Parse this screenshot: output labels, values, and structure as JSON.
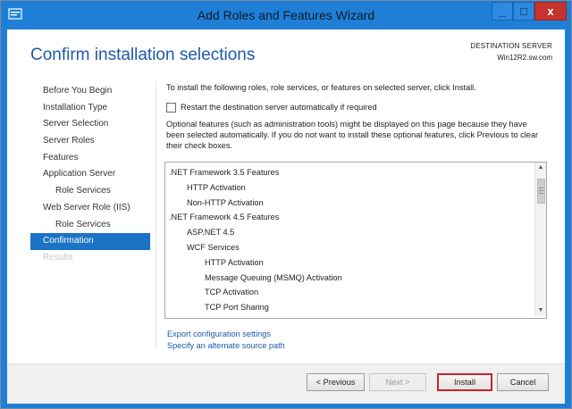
{
  "window": {
    "title": "Add Roles and Features Wizard",
    "controls": {
      "minimize": "_",
      "maximize": "□",
      "close": "x"
    }
  },
  "header": {
    "title": "Confirm installation selections",
    "destination_label": "DESTINATION SERVER",
    "destination_server": "Win12R2.sw.com"
  },
  "nav": {
    "items": [
      {
        "label": "Before You Begin",
        "level": 0,
        "state": "normal"
      },
      {
        "label": "Installation Type",
        "level": 0,
        "state": "normal"
      },
      {
        "label": "Server Selection",
        "level": 0,
        "state": "normal"
      },
      {
        "label": "Server Roles",
        "level": 0,
        "state": "normal"
      },
      {
        "label": "Features",
        "level": 0,
        "state": "normal"
      },
      {
        "label": "Application Server",
        "level": 0,
        "state": "normal"
      },
      {
        "label": "Role Services",
        "level": 1,
        "state": "normal"
      },
      {
        "label": "Web Server Role (IIS)",
        "level": 0,
        "state": "normal"
      },
      {
        "label": "Role Services",
        "level": 1,
        "state": "normal"
      },
      {
        "label": "Confirmation",
        "level": 0,
        "state": "active"
      },
      {
        "label": "Results",
        "level": 0,
        "state": "disabled"
      }
    ]
  },
  "content": {
    "intro": "To install the following roles, role services, or features on selected server, click Install.",
    "restart_checkbox": {
      "label": "Restart the destination server automatically if required",
      "checked": false
    },
    "optional_note": "Optional features (such as administration tools) might be displayed on this page because they have been selected automatically. If you do not want to install these optional features, click Previous to clear their check boxes."
  },
  "feature_list": {
    "items": [
      {
        "label": ".NET Framework 3.5 Features",
        "level": 0
      },
      {
        "label": "HTTP Activation",
        "level": 1
      },
      {
        "label": "Non-HTTP Activation",
        "level": 1
      },
      {
        "label": ".NET Framework 4.5 Features",
        "level": 0
      },
      {
        "label": "ASP.NET 4.5",
        "level": 1
      },
      {
        "label": "WCF Services",
        "level": 1
      },
      {
        "label": "HTTP Activation",
        "level": 2
      },
      {
        "label": "Message Queuing (MSMQ) Activation",
        "level": 2
      },
      {
        "label": "TCP Activation",
        "level": 2
      },
      {
        "label": "TCP Port Sharing",
        "level": 2
      }
    ]
  },
  "links": {
    "export": "Export configuration settings",
    "alternate_source": "Specify an alternate source path"
  },
  "footer": {
    "previous": "< Previous",
    "next": "Next >",
    "install": "Install",
    "cancel": "Cancel"
  },
  "colors": {
    "title_bar": "#1f7fd6",
    "accent": "#1a73c4",
    "header_text": "#1e5aa8",
    "install_highlight": "#c9242b"
  }
}
